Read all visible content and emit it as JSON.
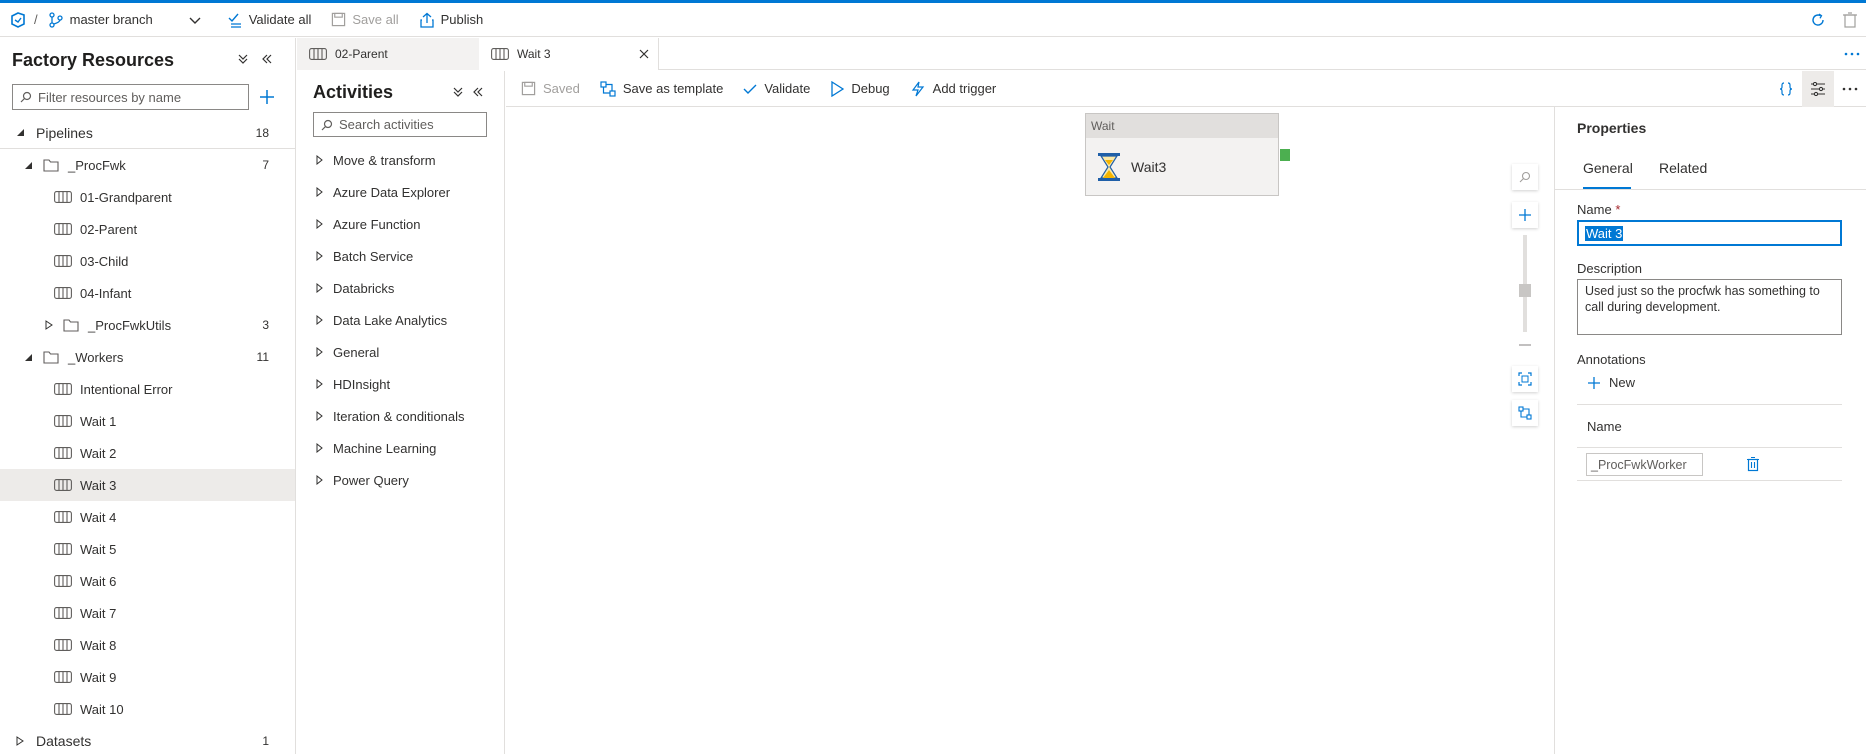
{
  "topbar": {
    "branch_label": "master branch",
    "separator": "/",
    "validate_all": "Validate all",
    "save_all": "Save all",
    "publish": "Publish"
  },
  "factory": {
    "title": "Factory Resources",
    "filter_placeholder": "Filter resources by name",
    "pipelines_label": "Pipelines",
    "pipelines_count": "18",
    "procfwk_label": "_ProcFwk",
    "procfwk_count": "7",
    "procfwk_items": [
      "01-Grandparent",
      "02-Parent",
      "03-Child",
      "04-Infant"
    ],
    "procfwkutils_label": "_ProcFwkUtils",
    "procfwkutils_count": "3",
    "workers_label": "_Workers",
    "workers_count": "11",
    "worker_items": [
      "Intentional Error",
      "Wait 1",
      "Wait 2",
      "Wait 3",
      "Wait 4",
      "Wait 5",
      "Wait 6",
      "Wait 7",
      "Wait 8",
      "Wait 9",
      "Wait 10"
    ],
    "selected_worker": "Wait 3",
    "datasets_label": "Datasets",
    "datasets_count": "1"
  },
  "tabs": [
    {
      "label": "02-Parent",
      "active": false
    },
    {
      "label": "Wait 3",
      "active": true
    }
  ],
  "activities": {
    "title": "Activities",
    "search_placeholder": "Search activities",
    "items": [
      "Move & transform",
      "Azure Data Explorer",
      "Azure Function",
      "Batch Service",
      "Databricks",
      "Data Lake Analytics",
      "General",
      "HDInsight",
      "Iteration & conditionals",
      "Machine Learning",
      "Power Query"
    ]
  },
  "canvas_toolbar": {
    "saved": "Saved",
    "save_as_template": "Save as template",
    "validate": "Validate",
    "debug": "Debug",
    "add_trigger": "Add trigger"
  },
  "node": {
    "type": "Wait",
    "name": "Wait3"
  },
  "properties": {
    "title": "Properties",
    "tab_general": "General",
    "tab_related": "Related",
    "name_label": "Name",
    "required_mark": "*",
    "name_value": "Wait 3",
    "description_label": "Description",
    "description_value": "Used just so the procfwk has something to call during development.",
    "annotations_label": "Annotations",
    "new_label": "New",
    "name_column": "Name",
    "annotation_value": "_ProcFwkWorker"
  },
  "colors": {
    "accent": "#0078d4",
    "node_output": "#4caf50",
    "selection_bg": "#edebe9"
  }
}
